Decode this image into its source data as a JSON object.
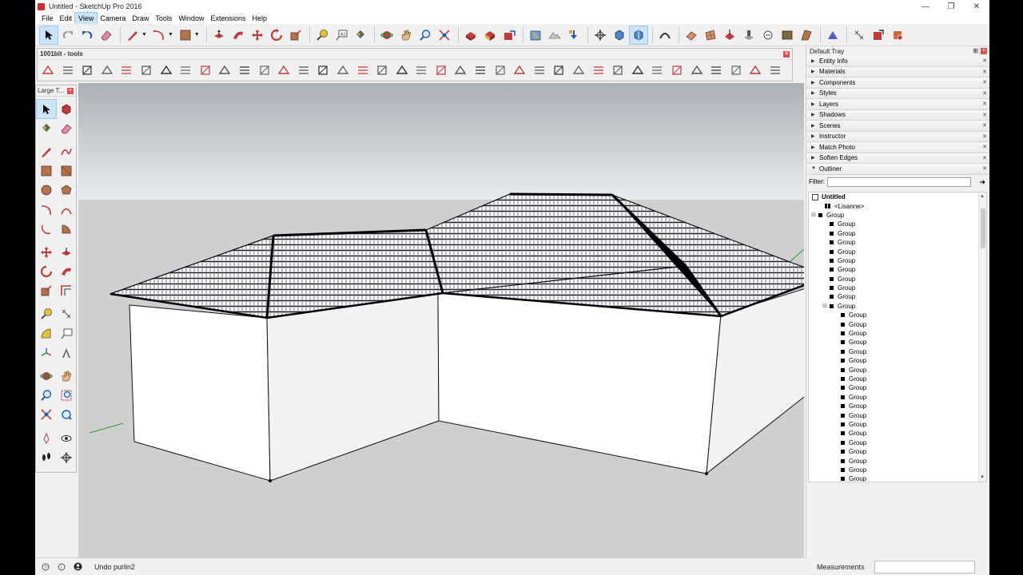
{
  "window": {
    "title": "Untitled - SketchUp Pro 2016",
    "controls": [
      "—",
      "❐",
      "✕"
    ]
  },
  "menu": [
    "File",
    "Edit",
    "View",
    "Camera",
    "Draw",
    "Tools",
    "Window",
    "Extensions",
    "Help"
  ],
  "active_menu": "View",
  "tools_1001": {
    "title": "1001bit - tools",
    "icon_count": 38
  },
  "large_tools": {
    "title": "Large T..."
  },
  "tray": {
    "title": "Default Tray",
    "panels": [
      {
        "label": "Entity Info",
        "expanded": false
      },
      {
        "label": "Materials",
        "expanded": false
      },
      {
        "label": "Components",
        "expanded": false
      },
      {
        "label": "Styles",
        "expanded": false
      },
      {
        "label": "Layers",
        "expanded": false
      },
      {
        "label": "Shadows",
        "expanded": false
      },
      {
        "label": "Scenes",
        "expanded": false
      },
      {
        "label": "Instructor",
        "expanded": false
      },
      {
        "label": "Match Photo",
        "expanded": false
      },
      {
        "label": "Soften Edges",
        "expanded": false
      },
      {
        "label": "Outliner",
        "expanded": true
      }
    ],
    "filter_label": "Filter:",
    "filter_value": ""
  },
  "outliner": {
    "root": "Untitled",
    "component": "<Lisanne>",
    "group_label": "Group",
    "top_group_children": 9,
    "nested_group_children": 19
  },
  "status": {
    "text": "Undo purlin2",
    "measurements_label": "Measurements",
    "measurements_value": ""
  },
  "colors": {
    "sky_top": "#a9b0b6",
    "sky_bottom": "#e9ecee",
    "ground": "#cfcfcf",
    "wall": "#ffffff",
    "roof": "#b9b9c6",
    "selection": "#cce4f7"
  }
}
